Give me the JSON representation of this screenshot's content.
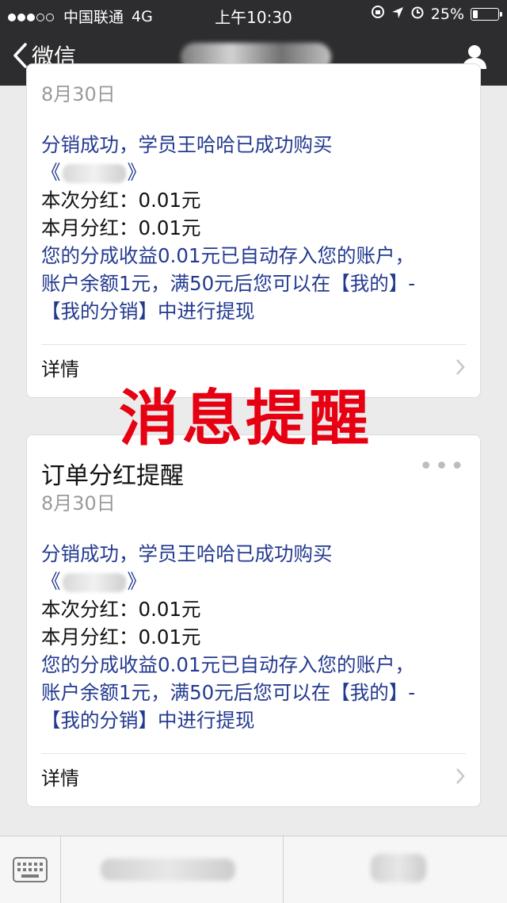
{
  "status_bar": {
    "carrier": "中国联通",
    "network": "4G",
    "time": "上午10:30",
    "battery": "25%"
  },
  "nav": {
    "back_label": "微信"
  },
  "cards": [
    {
      "title": "",
      "date": "8月30日",
      "line1": "分销成功，学员王哈哈已成功购买",
      "line2_open": "《",
      "line2_close": "》",
      "line3": "本次分红：0.01元",
      "line4": "本月分红：0.01元",
      "line5": "您的分成收益0.01元已自动存入您的账户，",
      "line6": "账户余额1元，满50元后您可以在【我的】-",
      "line7": "【我的分销】中进行提现",
      "detail": "详情"
    },
    {
      "title": "订单分红提醒",
      "date": "8月30日",
      "more": "•••",
      "line1": "分销成功，学员王哈哈已成功购买",
      "line2_open": "《",
      "line2_close": "》",
      "line3": "本次分红：0.01元",
      "line4": "本月分红：0.01元",
      "line5": "您的分成收益0.01元已自动存入您的账户，",
      "line6": "账户余额1元，满50元后您可以在【我的】-",
      "line7": "【我的分销】中进行提现",
      "detail": "详情"
    }
  ],
  "overlay": {
    "stamp_text": "消息提醒",
    "stamp_color": "#e60012"
  },
  "colors": {
    "nav_bg": "#2d2d2f",
    "message_blue": "#233a8f",
    "page_bg": "#ebebeb"
  },
  "bottom_bar": {
    "keyboard_icon": "keyboard-icon"
  }
}
